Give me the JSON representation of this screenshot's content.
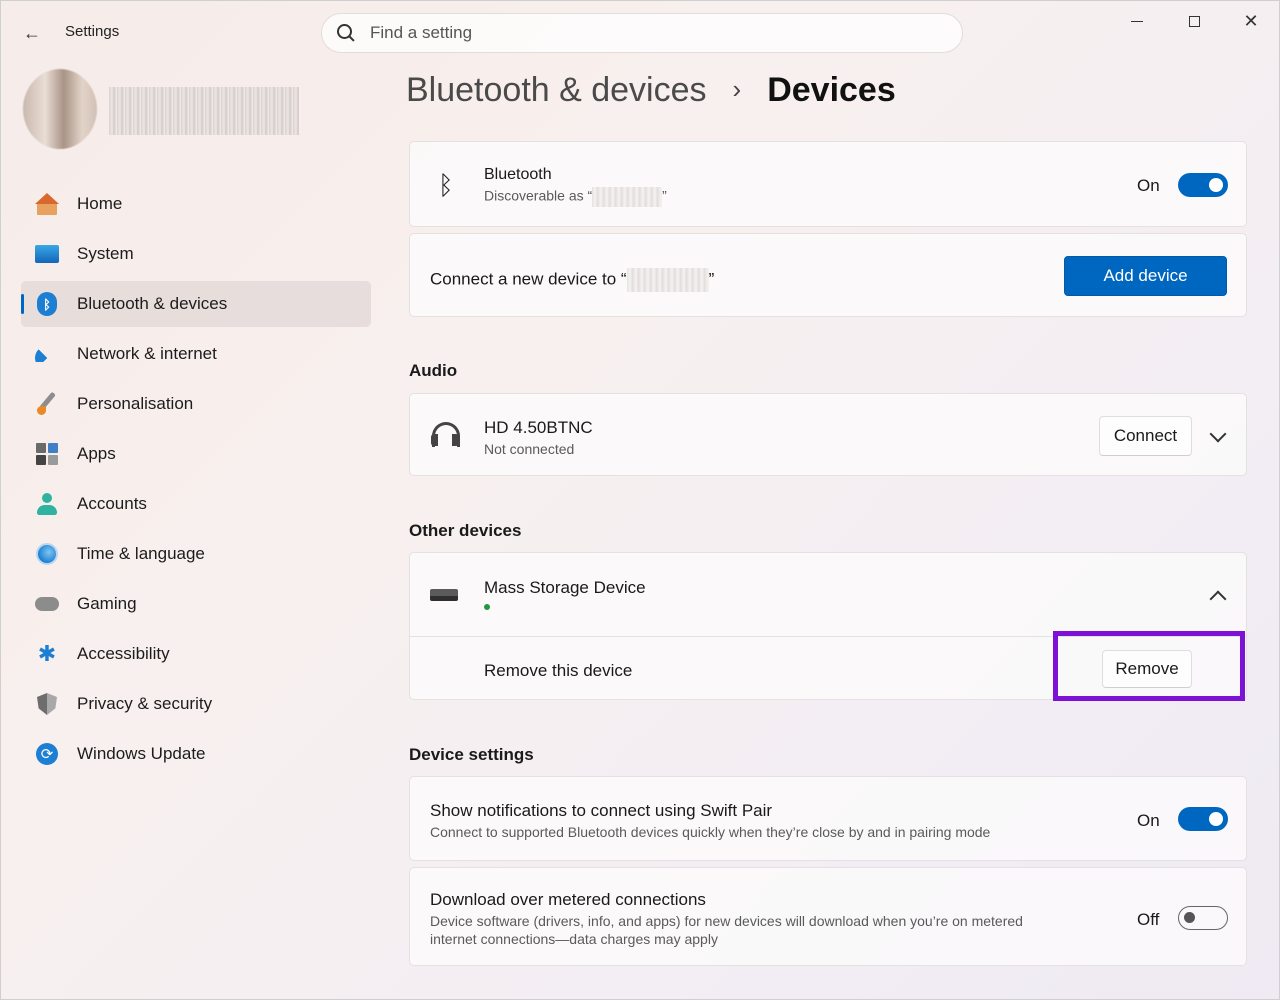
{
  "app": {
    "title": "Settings"
  },
  "search": {
    "placeholder": "Find a setting"
  },
  "sidebar": {
    "items": [
      {
        "label": "Home",
        "icon": "home-icon"
      },
      {
        "label": "System",
        "icon": "system-icon"
      },
      {
        "label": "Bluetooth & devices",
        "icon": "bluetooth-icon",
        "active": true
      },
      {
        "label": "Network & internet",
        "icon": "wifi-icon"
      },
      {
        "label": "Personalisation",
        "icon": "paintbrush-icon"
      },
      {
        "label": "Apps",
        "icon": "apps-icon"
      },
      {
        "label": "Accounts",
        "icon": "person-icon"
      },
      {
        "label": "Time & language",
        "icon": "globe-clock-icon"
      },
      {
        "label": "Gaming",
        "icon": "gamepad-icon"
      },
      {
        "label": "Accessibility",
        "icon": "accessibility-icon"
      },
      {
        "label": "Privacy & security",
        "icon": "shield-icon"
      },
      {
        "label": "Windows Update",
        "icon": "update-icon"
      }
    ]
  },
  "breadcrumb": {
    "parent": "Bluetooth & devices",
    "separator": "›",
    "current": "Devices"
  },
  "bluetooth": {
    "title": "Bluetooth",
    "subtitle_prefix": "Discoverable as “",
    "subtitle_suffix": "”",
    "toggle_label": "On",
    "toggle_on": true
  },
  "connect_new": {
    "text_prefix": "Connect a new device to “",
    "text_suffix": "”",
    "button_label": "Add device"
  },
  "audio": {
    "heading": "Audio",
    "device": {
      "name": "HD 4.50BTNC",
      "status": "Not connected",
      "button_label": "Connect"
    }
  },
  "other_devices": {
    "heading": "Other devices",
    "device": {
      "name": "Mass Storage Device",
      "remove_text": "Remove this device",
      "remove_label": "Remove"
    }
  },
  "device_settings": {
    "heading": "Device settings",
    "swift_pair": {
      "title": "Show notifications to connect using Swift Pair",
      "subtitle": "Connect to supported Bluetooth devices quickly when they’re close by and in pairing mode",
      "toggle_label": "On",
      "toggle_on": true
    },
    "metered": {
      "title": "Download over metered connections",
      "subtitle_line1": "Device software (drivers, info, and apps) for new devices will download when you’re on metered",
      "subtitle_line2": "internet connections—data charges may apply",
      "toggle_label": "Off",
      "toggle_on": false
    }
  },
  "colors": {
    "accent": "#0067c0",
    "highlight": "#7d12d6",
    "status_connected": "#1e9a3d"
  }
}
